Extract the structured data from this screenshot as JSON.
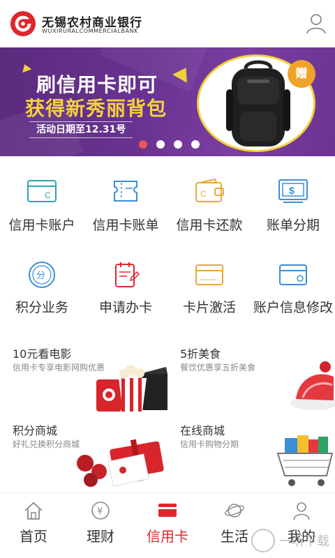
{
  "header": {
    "bank_name": "无锡农村商业银行",
    "bank_name_en": "WUXIRURALCOMMERCIALBANK"
  },
  "banner": {
    "line1": "刷信用卡即可",
    "line2": "获得新秀丽背包",
    "date_text": "活动日期至12.31号",
    "gift_badge": "赠",
    "slide_count": 4,
    "active_slide": 0
  },
  "grid": {
    "items": [
      {
        "label": "信用卡账户",
        "icon": "credit-card-account-icon"
      },
      {
        "label": "信用卡账单",
        "icon": "bill-icon"
      },
      {
        "label": "信用卡还款",
        "icon": "wallet-repay-icon"
      },
      {
        "label": "账单分期",
        "icon": "installment-icon"
      },
      {
        "label": "积分业务",
        "icon": "points-icon"
      },
      {
        "label": "申请办卡",
        "icon": "apply-card-icon"
      },
      {
        "label": "卡片激活",
        "icon": "card-activate-icon"
      },
      {
        "label": "账户信息修改",
        "icon": "account-edit-icon"
      }
    ]
  },
  "promos": [
    {
      "title": "10元看电影",
      "desc": "信用卡专享电影网购优惠"
    },
    {
      "title": "5折美食",
      "desc": "餐饮优惠享五折美食"
    },
    {
      "title": "积分商城",
      "desc": "好礼兑换积分商城"
    },
    {
      "title": "在线商城",
      "desc": "信用卡购物分期"
    }
  ],
  "nav": {
    "items": [
      {
        "label": "首页",
        "icon": "home-icon"
      },
      {
        "label": "理财",
        "icon": "finance-icon"
      },
      {
        "label": "信用卡",
        "icon": "credit-card-icon"
      },
      {
        "label": "生活",
        "icon": "planet-icon"
      },
      {
        "label": "我的",
        "icon": "profile-icon"
      }
    ],
    "active_index": 2
  },
  "watermark": "一听下载",
  "colors": {
    "brand_red": "#e0262e",
    "banner_purple": "#6a3391",
    "banner_yellow": "#f4d03f",
    "icon_blue": "#3a8fd8"
  }
}
